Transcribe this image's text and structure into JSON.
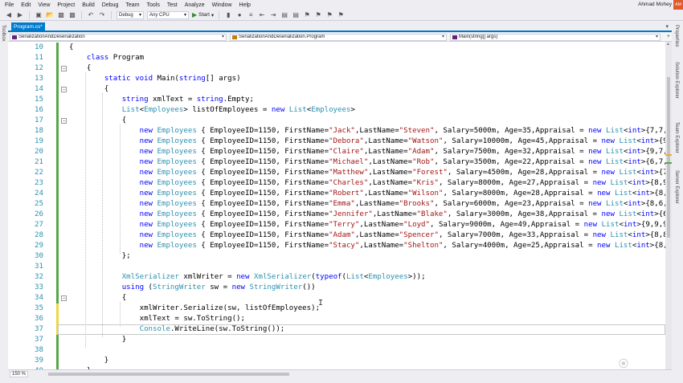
{
  "menu": {
    "items": [
      "File",
      "Edit",
      "View",
      "Project",
      "Build",
      "Debug",
      "Team",
      "Tools",
      "Test",
      "Analyze",
      "Window",
      "Help"
    ],
    "user_name": "Ahmad Mohey",
    "avatar_initials": "AM"
  },
  "toolbar": {
    "config_select": "Debug",
    "platform_select": "Any CPU",
    "start_label": "Start"
  },
  "left_strip": {
    "label": "Toolbox"
  },
  "right_strip": {
    "labels": [
      "Properties",
      "Solution Explorer",
      "Team Explorer",
      "Server Explorer"
    ]
  },
  "tab": {
    "label": "Program.cs*",
    "close": "×"
  },
  "navbar": {
    "project": "SerializationAndDeserialization",
    "class": "SerializationAndDeserialization.Program",
    "member": "Main(string[] args)"
  },
  "editor": {
    "current_line": 37,
    "lines": [
      {
        "n": "10",
        "t": "{"
      },
      {
        "n": "11",
        "t": "    class Program"
      },
      {
        "n": "12",
        "t": "    {"
      },
      {
        "n": "13",
        "t": "        static void Main(string[] args)"
      },
      {
        "n": "14",
        "t": "        {"
      },
      {
        "n": "15",
        "t": "            string xmlText = string.Empty;"
      },
      {
        "n": "16",
        "t": "            List<Employees> listOfEmployees = new List<Employees>"
      },
      {
        "n": "17",
        "t": "            {"
      },
      {
        "n": "18",
        "t": "                new Employees { EmployeeID=1150, FirstName=\"Jack\",LastName=\"Steven\", Salary=5000m, Age=35,Appraisal = new List<int>{7,7,8"
      },
      {
        "n": "19",
        "t": "                new Employees { EmployeeID=1150, FirstName=\"Debora\",LastName=\"Watson\", Salary=10000m, Age=45,Appraisal = new List<int>{9,9"
      },
      {
        "n": "20",
        "t": "                new Employees { EmployeeID=1150, FirstName=\"Claire\",LastName=\"Adam\", Salary=7500m, Age=32,Appraisal = new List<int>{9,7,8"
      },
      {
        "n": "21",
        "t": "                new Employees { EmployeeID=1150, FirstName=\"Michael\",LastName=\"Rob\", Salary=3500m, Age=22,Appraisal = new List<int>{6,7,8"
      },
      {
        "n": "22",
        "t": "                new Employees { EmployeeID=1150, FirstName=\"Matthew\",LastName=\"Forest\", Salary=4500m, Age=28,Appraisal = new List<int>{7,"
      },
      {
        "n": "23",
        "t": "                new Employees { EmployeeID=1150, FirstName=\"Charles\",LastName=\"Kris\", Salary=8000m, Age=27,Appraisal = new List<int>{8,9"
      },
      {
        "n": "24",
        "t": "                new Employees { EmployeeID=1150, FirstName=\"Robert\",LastName=\"Wilson\", Salary=8000m, Age=28,Appraisal = new List<int>{8,9"
      },
      {
        "n": "25",
        "t": "                new Employees { EmployeeID=1150, FirstName=\"Emma\",LastName=\"Brooks\", Salary=6000m, Age=23,Appraisal = new List<int>{8,6,9"
      },
      {
        "n": "26",
        "t": "                new Employees { EmployeeID=1150, FirstName=\"Jennifer\",LastName=\"Blake\", Salary=3000m, Age=38,Appraisal = new List<int>{6"
      },
      {
        "n": "27",
        "t": "                new Employees { EmployeeID=1150, FirstName=\"Terry\",LastName=\"Loyd\", Salary=9000m, Age=49,Appraisal = new List<int>{9,9,9"
      },
      {
        "n": "28",
        "t": "                new Employees { EmployeeID=1150, FirstName=\"Adam\",LastName=\"Spencer\", Salary=7000m, Age=33,Appraisal = new List<int>{8,8"
      },
      {
        "n": "29",
        "t": "                new Employees { EmployeeID=1150, FirstName=\"Stacy\",LastName=\"Shelton\", Salary=4000m, Age=25,Appraisal = new List<int>{8,7"
      },
      {
        "n": "30",
        "t": "            };"
      },
      {
        "n": "31",
        "t": ""
      },
      {
        "n": "32",
        "t": "            XmlSerializer xmlWriter = new XmlSerializer(typeof(List<Employees>));"
      },
      {
        "n": "33",
        "t": "            using (StringWriter sw = new StringWriter())"
      },
      {
        "n": "34",
        "t": "            {"
      },
      {
        "n": "35",
        "t": "                xmlWriter.Serialize(sw, listOfEmployees);"
      },
      {
        "n": "36",
        "t": "                xmlText = sw.ToString();"
      },
      {
        "n": "37",
        "t": "                Console.WriteLine(sw.ToString());"
      },
      {
        "n": "37",
        "t": "            }"
      },
      {
        "n": "38",
        "t": ""
      },
      {
        "n": "39",
        "t": "        }"
      },
      {
        "n": "40",
        "t": "    }"
      }
    ]
  },
  "status": {
    "zoom": "150 %"
  },
  "colors": {
    "keyword": "#0000ff",
    "type": "#2b91af",
    "string": "#a31515",
    "accent": "#007acc",
    "change_saved": "#57a64a",
    "change_unsaved": "#efd645"
  }
}
